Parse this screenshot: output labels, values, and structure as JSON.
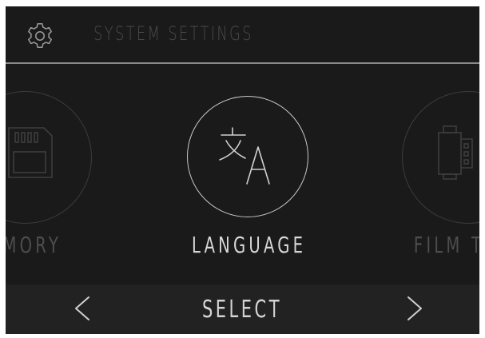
{
  "header": {
    "title": "SYSTEM SETTINGS",
    "icon": "gear-icon"
  },
  "carousel": {
    "items": [
      {
        "label": "EMORY",
        "icon": "sd-card-icon",
        "state": "inactive"
      },
      {
        "label": "LANGUAGE",
        "icon": "translate-icon",
        "state": "selected"
      },
      {
        "label": "FILM T",
        "icon": "film-roll-icon",
        "state": "inactive"
      }
    ]
  },
  "footer": {
    "prev_icon": "chevron-left-icon",
    "select_label": "SELECT",
    "next_icon": "chevron-right-icon"
  },
  "colors": {
    "background": "#1b1a1a",
    "footer_background": "#222222",
    "divider": "#8a8a8a",
    "active_text": "#d8d8d8",
    "inactive_text": "#4d4d4d",
    "header_title": "#4a4a4a"
  }
}
